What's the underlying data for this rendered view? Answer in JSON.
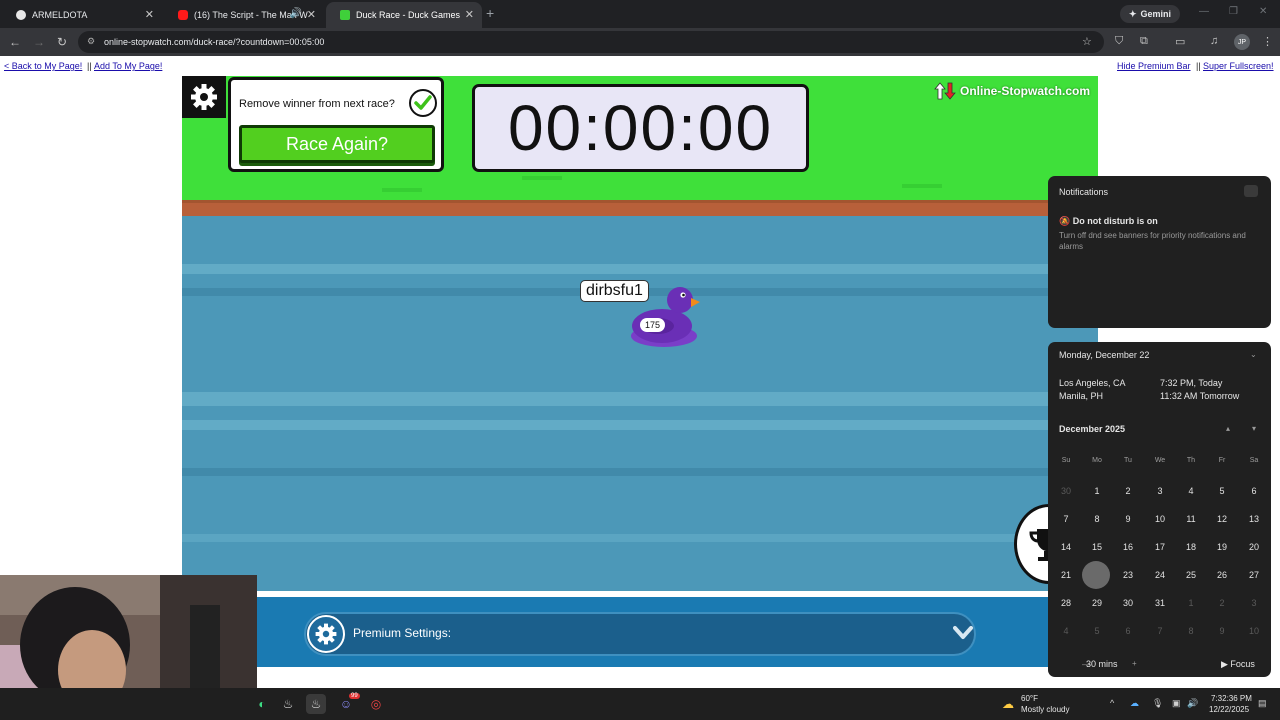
{
  "browser": {
    "tabs": [
      {
        "title": "ARMELDOTA",
        "active": false
      },
      {
        "title": "(16) The Script - The Man W",
        "active": false
      },
      {
        "title": "Duck Race - Duck Games",
        "active": true
      }
    ],
    "gemini_label": "Gemini",
    "url": "online-stopwatch.com/duck-race/?countdown=00:05:00",
    "profile_initials": "JP"
  },
  "page": {
    "links_left": [
      "< Back to My Page!",
      "Add To My Page!"
    ],
    "links_right": [
      "Hide Premium Bar",
      "Super Fullscreen!"
    ],
    "separator": "||"
  },
  "game": {
    "remove_winner_label": "Remove winner from next race?",
    "remove_winner_checked": true,
    "race_again_label": "Race Again?",
    "timer": "00:00:00",
    "brand": "Online-Stopwatch.com",
    "duck": {
      "name": "dirbsfu1",
      "number": "175",
      "color": "#6a2fb6"
    },
    "premium_label": "Premium Settings:",
    "colors": {
      "grass": "#3fe03a",
      "water": "#4c98b8",
      "button": "#52cf1f"
    }
  },
  "notifications": {
    "title": "Notifications",
    "dnd_title": "Do not disturb is on",
    "dnd_body": "Turn off dnd see banners for priority notifications and alarms"
  },
  "calendar": {
    "date_header": "Monday, December 22",
    "clocks": [
      {
        "city": "Los Angeles, CA",
        "time": "7:32 PM, Today"
      },
      {
        "city": "Manila, PH",
        "time": "11:32 AM Tomorrow"
      }
    ],
    "month_label": "December 2025",
    "weekdays": [
      "Su",
      "Mo",
      "Tu",
      "We",
      "Th",
      "Fr",
      "Sa"
    ],
    "weeks": [
      [
        "30",
        "1",
        "2",
        "3",
        "4",
        "5",
        "6"
      ],
      [
        "7",
        "8",
        "9",
        "10",
        "11",
        "12",
        "13"
      ],
      [
        "14",
        "15",
        "16",
        "17",
        "18",
        "19",
        "20"
      ],
      [
        "21",
        "22",
        "23",
        "24",
        "25",
        "26",
        "27"
      ],
      [
        "28",
        "29",
        "30",
        "31",
        "1",
        "2",
        "3"
      ],
      [
        "4",
        "5",
        "6",
        "7",
        "8",
        "9",
        "10"
      ]
    ],
    "today": "22",
    "focus_minutes": "30 mins",
    "focus_label": "Focus"
  },
  "taskbar": {
    "weather_temp": "60°F",
    "weather_desc": "Mostly cloudy",
    "time": "7:32:36 PM",
    "date": "12/22/2025",
    "discord_badge": "99"
  }
}
